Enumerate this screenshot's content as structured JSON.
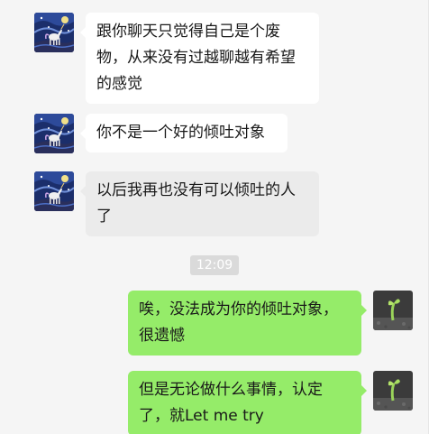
{
  "messages": [
    {
      "side": "left",
      "text": "跟你聊天只觉得自己是个废物，从来没有过越聊越有希望的感觉",
      "avatar": "starry-night-unicorn-avatar"
    },
    {
      "side": "left",
      "text": "你不是一个好的倾吐对象",
      "avatar": "starry-night-unicorn-avatar"
    },
    {
      "side": "left",
      "text": "以后我再也没有可以倾吐的人了",
      "avatar": "starry-night-unicorn-avatar"
    },
    {
      "side": "right",
      "text": "唉，没法成为你的倾吐对象，很遗憾",
      "avatar": "sprout-avatar"
    },
    {
      "side": "right",
      "text": "但是无论做什么事情，认定了，就Let me try",
      "avatar": "sprout-avatar"
    }
  ],
  "timestamp": "12:09",
  "colors": {
    "background": "#f5f5f5",
    "incoming_bubble": "#ffffff",
    "outgoing_bubble": "#95ec69",
    "timestamp_bg": "#dadada"
  }
}
